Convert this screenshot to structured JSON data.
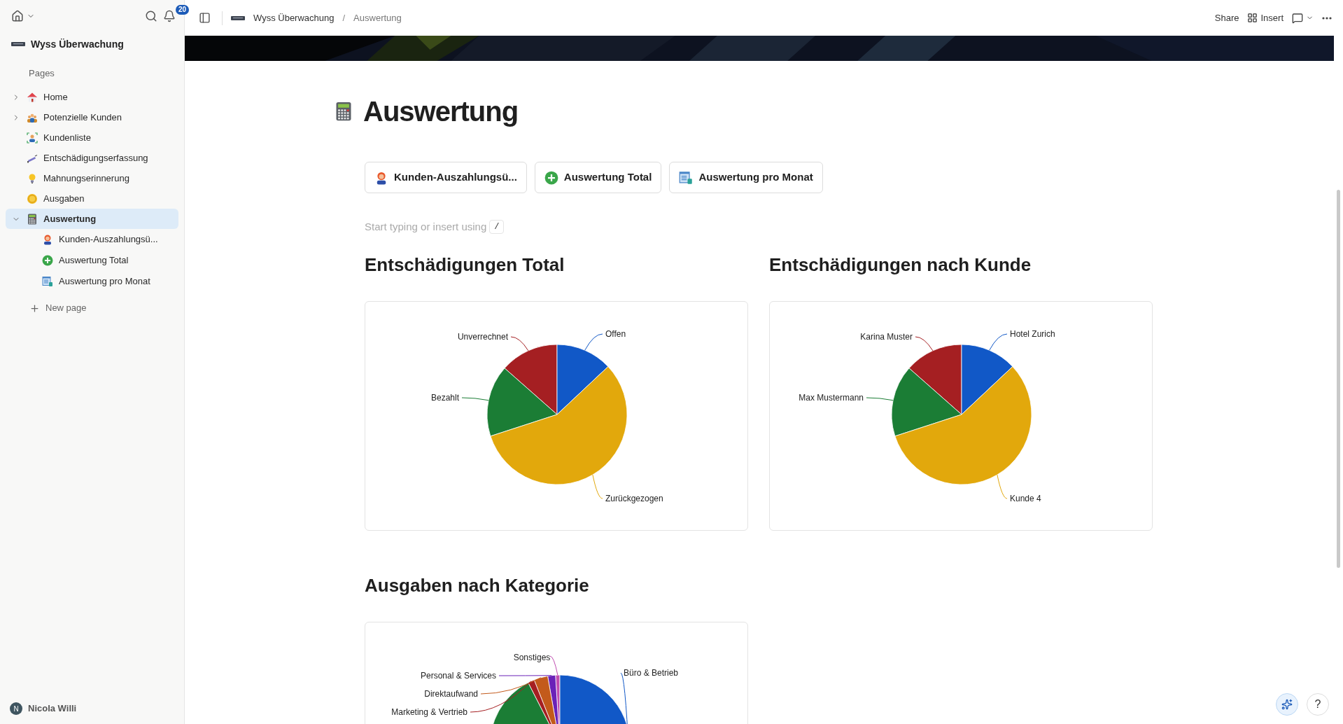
{
  "sidebar": {
    "notification_badge": "20",
    "workspace": "Wyss Überwachung",
    "section_label": "Pages",
    "items": [
      {
        "label": "Home",
        "kind": "folder",
        "expanded": false,
        "selected": false
      },
      {
        "label": "Potenzielle Kunden",
        "kind": "folder",
        "expanded": false,
        "selected": false
      },
      {
        "label": "Kundenliste",
        "kind": "page",
        "selected": false
      },
      {
        "label": "Entschädigungserfassung",
        "kind": "page",
        "selected": false
      },
      {
        "label": "Mahnungserinnerung",
        "kind": "page",
        "selected": false
      },
      {
        "label": "Ausgaben",
        "kind": "page",
        "selected": false
      },
      {
        "label": "Auswertung",
        "kind": "folder",
        "expanded": true,
        "selected": true,
        "children": [
          {
            "label": "Kunden-Auszahlungsü...",
            "selected": false
          },
          {
            "label": "Auswertung Total",
            "selected": false
          },
          {
            "label": "Auswertung pro Monat",
            "selected": false
          }
        ]
      }
    ],
    "new_page": "New page",
    "user": {
      "initial": "N",
      "name": "Nicola Willi"
    }
  },
  "topbar": {
    "breadcrumb": [
      "Wyss Überwachung",
      "Auswertung"
    ],
    "separator": "/",
    "share": "Share",
    "insert": "Insert"
  },
  "page": {
    "title": "Auswertung",
    "links": [
      "Kunden-Auszahlungsü...",
      "Auswertung Total",
      "Auswertung pro Monat"
    ],
    "placeholder": "Start typing or insert using",
    "shortcut": "/",
    "charts": [
      {
        "title": "Entschädigungen Total",
        "slices": [
          {
            "label": "Unverrechnet",
            "color": "#a51f22"
          },
          {
            "label": "Offen",
            "color": "#1158c7"
          },
          {
            "label": "Bezahlt",
            "color": "#1b7d35"
          },
          {
            "label": "Zurückgezogen",
            "color": "#e2a80c"
          }
        ]
      },
      {
        "title": "Entschädigungen nach Kunde",
        "slices": [
          {
            "label": "Karina Muster",
            "color": "#a51f22"
          },
          {
            "label": "Hotel Zurich",
            "color": "#1158c7"
          },
          {
            "label": "Max Mustermann",
            "color": "#1b7d35"
          },
          {
            "label": "Kunde 4",
            "color": "#e2a80c"
          }
        ]
      },
      {
        "title": "Ausgaben nach Kategorie",
        "slices": [
          {
            "label": "Sonstiges",
            "color": "#c04bb0"
          },
          {
            "label": "Büro & Betrieb",
            "color": "#1158c7"
          },
          {
            "label": "Personal & Services",
            "color": "#6a22b8"
          },
          {
            "label": "Direktaufwand",
            "color": "#c35a1b"
          },
          {
            "label": "Marketing & Vertrieb",
            "color": "#a51f22"
          },
          {
            "color": "#1b7d35"
          }
        ]
      }
    ]
  },
  "help": "?"
}
